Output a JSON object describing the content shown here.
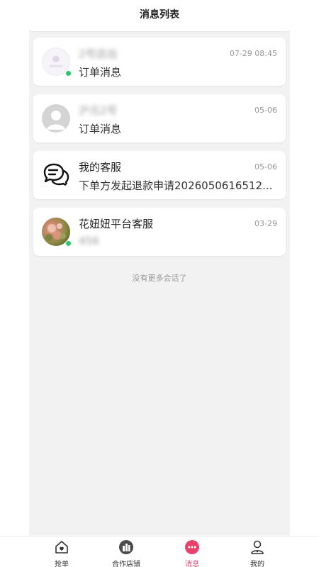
{
  "header": {
    "title": "消息列表"
  },
  "conversations": [
    {
      "name": "2号店出",
      "time": "07-29 08:45",
      "preview": "订单消息",
      "online": true,
      "avatar": "shop-logo-avatar",
      "name_blurred": true,
      "preview_blurred": false
    },
    {
      "name": "沪元2号",
      "time": "05-06",
      "preview": "订单消息",
      "online": false,
      "avatar": "default-user-avatar",
      "name_blurred": true,
      "preview_blurred": false
    },
    {
      "name": "我的客服",
      "time": "05-06",
      "preview": "下单方发起退款申请2026050616512...",
      "online": false,
      "avatar": "chat-bubbles-icon",
      "name_blurred": false,
      "preview_blurred": false
    },
    {
      "name": "花妞妞平台客服",
      "time": "03-29",
      "preview": "456",
      "online": true,
      "avatar": "flower-photo-avatar",
      "name_blurred": false,
      "preview_blurred": true
    }
  ],
  "footer_note": "没有更多会话了",
  "tabs": [
    {
      "label": "抢单",
      "icon": "house-heart-icon",
      "active": false
    },
    {
      "label": "合作店铺",
      "icon": "store-building-icon",
      "active": false
    },
    {
      "label": "消息",
      "icon": "message-dots-icon",
      "active": true
    },
    {
      "label": "我的",
      "icon": "user-profile-icon",
      "active": false
    }
  ],
  "colors": {
    "accent": "#e8416a",
    "online": "#28c76f",
    "background": "#f2f2f2"
  }
}
